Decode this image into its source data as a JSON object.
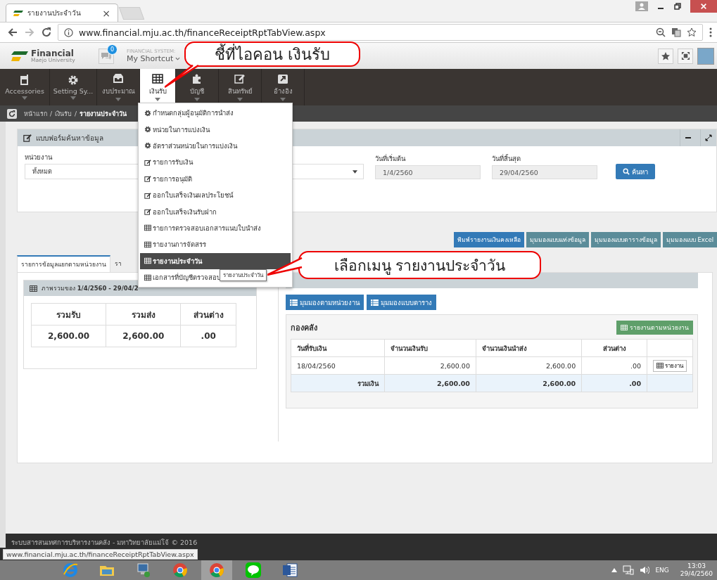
{
  "browser": {
    "tab_title": "รายงานประจำวัน",
    "tab_close": "×",
    "url": "www.financial.mju.ac.th/financeReceiptRptTabView.aspx"
  },
  "header": {
    "logo": "Financial",
    "logo_sub": "Maejo University",
    "notification_count": "0",
    "system_label": "FINANCIAL SYSTEM:",
    "shortcut": "My Shortcut"
  },
  "nav": [
    {
      "label": "Accessories",
      "kind": "tablet",
      "selected": false
    },
    {
      "label": "Setting Sy...",
      "kind": "gear",
      "selected": false
    },
    {
      "label": "งบประมาณ",
      "kind": "inbox",
      "selected": false
    },
    {
      "label": "เงินรับ",
      "kind": "grid",
      "selected": true
    },
    {
      "label": "บัญชี",
      "kind": "puzzle",
      "selected": false
    },
    {
      "label": "สินทรัพย์",
      "kind": "edit",
      "selected": false
    },
    {
      "label": "อ้างอิง",
      "kind": "share",
      "selected": false
    }
  ],
  "breadcrumb": [
    "หน้าแรก",
    "/",
    "เงินรับ",
    "/",
    "รายงานประจำวัน"
  ],
  "search_panel": {
    "title": "แบบฟอร์มค้นหาข้อมูล",
    "unit_label": "หน่วยงาน",
    "unit_value": "ทั้งหมด",
    "start_label": "วันที่เริ่มต้น",
    "start_value": "1/4/2560",
    "end_label": "วันที่สิ้นสุด",
    "end_value": "29/04/2560",
    "search_button": "ค้นหา"
  },
  "view_buttons": [
    {
      "label": "พิมพ์รายงานเงินคงเหลือ",
      "kind": "primary"
    },
    {
      "label": "มุมมองแบบแท่งข้อมูล",
      "kind": "info"
    },
    {
      "label": "มุมมองแบบตารางข้อมูล",
      "kind": "info"
    },
    {
      "label": "มุมมองแบบ Excel",
      "kind": "info"
    }
  ],
  "result_tabs": [
    {
      "label": "รายการข้อมูลแยกตามหน่วยงาน",
      "selected": true
    },
    {
      "label": "รา",
      "selected": false
    }
  ],
  "summary": {
    "title": "ภาพรวมของ **1/4/2560 - 29/04/2**",
    "columns": [
      "รวมรับ",
      "รวมส่ง",
      "ส่วนต่าง"
    ],
    "values": [
      "2,600.00",
      "2,600.00",
      ".00"
    ]
  },
  "detail": {
    "buttons": [
      "มุมมองตามหน่วยงาน",
      "มุมมองแบบตาราง"
    ],
    "unit_title": "กองคลัง",
    "unit_report_button": "รายงานตามหน่วยงาน",
    "columns": [
      "วันที่รับเงิน",
      "จำนวนเงินรับ",
      "จำนวนเงินนำส่ง",
      "ส่วนต่าง"
    ],
    "rows": [
      {
        "cells": [
          "18/04/2560",
          "2,600.00",
          "2,600.00",
          ".00"
        ],
        "action": "รายงาน"
      }
    ],
    "total": {
      "label": "รวมเงิน",
      "cells": [
        "2,600.00",
        "2,600.00",
        ".00"
      ]
    }
  },
  "dropdown": {
    "items": [
      {
        "label": "กำหนดกลุ่มผู้อนุมัติการนำส่ง",
        "kind": "gear",
        "selected": false
      },
      {
        "label": "หน่วยในการแบ่งเงิน",
        "kind": "gear",
        "selected": false
      },
      {
        "label": "อัตราส่วนหน่วยในการแบ่งเงิน",
        "kind": "gear",
        "selected": false
      },
      {
        "label": "รายการรับเงิน",
        "kind": "edit",
        "selected": false
      },
      {
        "label": "รายการอนุมัติ",
        "kind": "edit",
        "selected": false
      },
      {
        "label": "ออกใบเสร็จเงินผลประโยชน์",
        "kind": "edit",
        "selected": false
      },
      {
        "label": "ออกใบเสร็จเงินรับฝาก",
        "kind": "edit",
        "selected": false
      },
      {
        "label": "รายการตรวจสอบเอกสารแนบใบนำส่ง",
        "kind": "table",
        "selected": false
      },
      {
        "label": "รายงานการจัดสรร",
        "kind": "table",
        "selected": false
      },
      {
        "label": "รายงานประจำวัน",
        "kind": "table",
        "selected": true
      },
      {
        "label": "เอกสารที่บัญชีตรวจสอบ",
        "kind": "table",
        "selected": false
      }
    ],
    "tooltip": "รายงานประจำวัน"
  },
  "callouts": [
    {
      "text": "ชี้ที่ไอคอน เงินรับ"
    },
    {
      "text": "เลือกเมนู รายงานประจำวัน"
    }
  ],
  "footer": "ระบบสารสนเทศการบริหารงานคลัง - มหาวิทยาลัยแม่โจ้ © 2016",
  "status_url": "www.financial.mju.ac.th/financeReceiptRptTabView.aspx",
  "taskbar": {
    "apps": [
      {
        "kind": "ie",
        "selected": false
      },
      {
        "kind": "folder",
        "selected": false
      },
      {
        "kind": "computer",
        "selected": false
      },
      {
        "kind": "chrome",
        "selected": false
      },
      {
        "kind": "chrome",
        "selected": true
      },
      {
        "kind": "chat",
        "selected": false
      },
      {
        "kind": "word",
        "selected": false
      }
    ],
    "language": "ENG",
    "time": "13:03",
    "date": "29/4/2560"
  }
}
